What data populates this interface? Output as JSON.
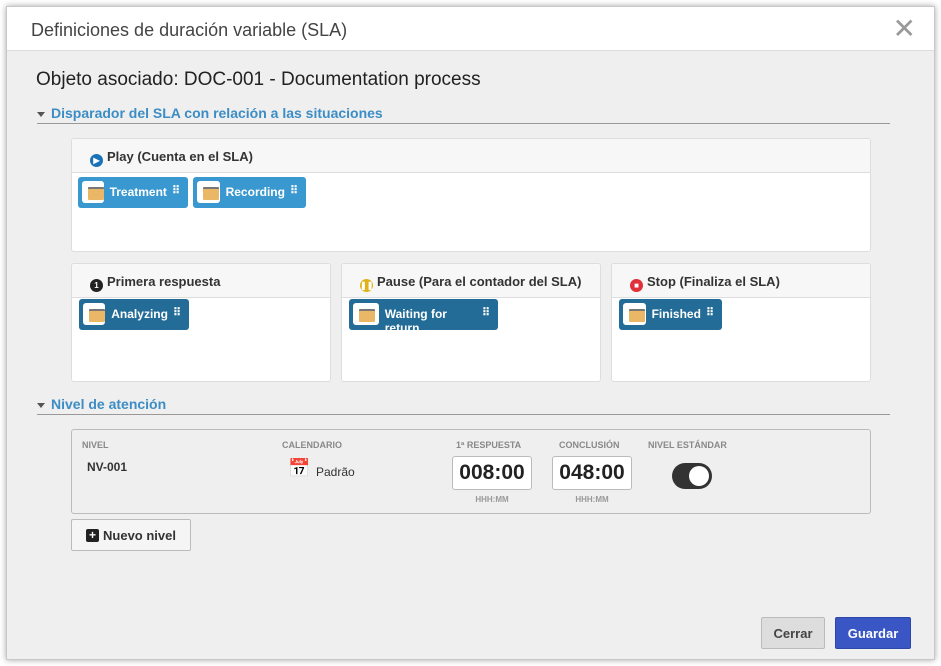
{
  "dialog": {
    "title": "Definiciones de duración variable (SLA)",
    "close_icon": "close-icon",
    "associated": "Objeto asociado: DOC-001 - Documentation process"
  },
  "trigger_section": {
    "title": "Disparador del SLA con relación a las situaciones",
    "play": {
      "label": "Play (Cuenta en el SLA)",
      "color": "#1a73b8",
      "items": [
        "Treatment",
        "Recording"
      ]
    },
    "first_response": {
      "label": "Primera respuesta",
      "items": [
        "Analyzing"
      ]
    },
    "pause": {
      "label": "Pause (Para el contador del SLA)",
      "color": "#e0b21a",
      "items": [
        "Waiting for return"
      ]
    },
    "stop": {
      "label": "Stop (Finaliza el SLA)",
      "color": "#e0303a",
      "items": [
        "Finished"
      ]
    }
  },
  "level_section": {
    "title": "Nivel de atención",
    "headers": {
      "level": "NIVEL",
      "calendar": "CALENDARIO",
      "first_response": "1ª RESPUESTA",
      "conclusion": "CONCLUSIÓN",
      "standard": "NIVEL ESTÁNDAR"
    },
    "row": {
      "level": "NV-001",
      "calendar": "Padrão",
      "first_response": "008:00",
      "conclusion": "048:00",
      "format": "HHH:MM",
      "standard": true
    },
    "new_level": "Nuevo nivel"
  },
  "footer": {
    "close": "Cerrar",
    "save": "Guardar",
    "save_color": "#3a56c4"
  }
}
